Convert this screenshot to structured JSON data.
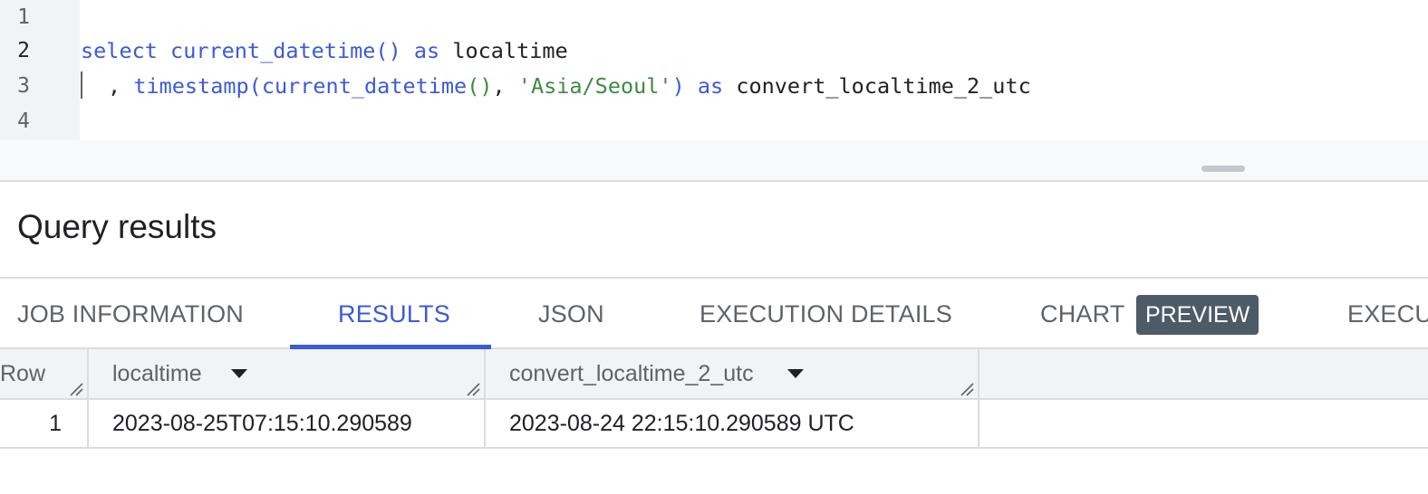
{
  "editor": {
    "line_numbers": [
      "1",
      "2",
      "3",
      "4"
    ],
    "line2": {
      "kw_select": "select",
      "fn": "current_datetime",
      "parens": "()",
      "kw_as": "as",
      "alias": "localtime"
    },
    "line3": {
      "comma": ",",
      "fn_timestamp": "timestamp",
      "open_paren": "(",
      "fn_inner": "current_datetime",
      "inner_parens": "()",
      "sep": ",",
      "string": "'Asia/Seoul'",
      "close_paren": ")",
      "kw_as": "as",
      "alias": "convert_localtime_2_utc"
    }
  },
  "results": {
    "title": "Query results",
    "tabs": [
      {
        "label": "JOB INFORMATION"
      },
      {
        "label": "RESULTS"
      },
      {
        "label": "JSON"
      },
      {
        "label": "EXECUTION DETAILS"
      },
      {
        "label": "CHART"
      },
      {
        "label": "EXECU"
      }
    ],
    "preview_badge": "PREVIEW",
    "active_tab": "RESULTS"
  },
  "table": {
    "columns": [
      "Row",
      "localtime",
      "convert_localtime_2_utc"
    ],
    "rows": [
      {
        "row": "1",
        "localtime": "2023-08-25T07:15:10.290589",
        "convert_localtime_2_utc": "2023-08-24 22:15:10.290589 UTC"
      }
    ]
  },
  "colors": {
    "keyword": "#3b5bd6",
    "string": "#3d8b40",
    "active_tab": "#3b5bd6",
    "badge_bg": "#4d5b67"
  }
}
